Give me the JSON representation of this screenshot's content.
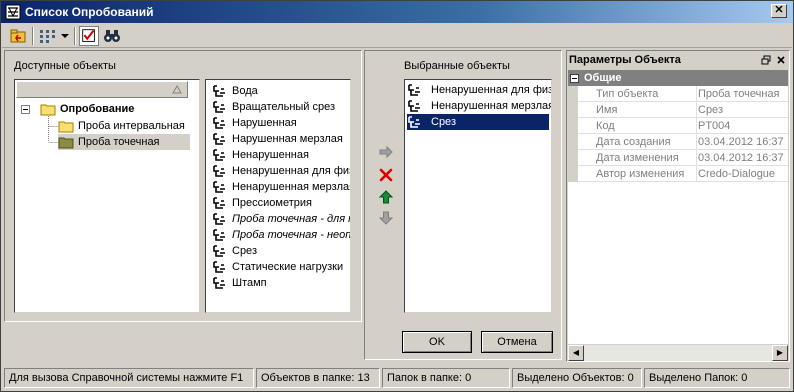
{
  "window": {
    "title": "Список Опробований",
    "close_glyph": "✕"
  },
  "toolbar": {
    "buttons": [
      {
        "icon": "open-folder-icon"
      },
      {
        "icon": "tree-view-icon"
      },
      {
        "icon": "checklist-icon"
      },
      {
        "icon": "binoculars-icon"
      }
    ]
  },
  "left": {
    "group_label": "Доступные объекты",
    "tree": {
      "root": "Опробование",
      "children": [
        "Проба интервальная",
        "Проба точечная"
      ]
    },
    "available_items": [
      {
        "label": "Вода",
        "italic": false
      },
      {
        "label": "Вращательный срез",
        "italic": false
      },
      {
        "label": "Нарушенная",
        "italic": false
      },
      {
        "label": "Нарушенная мерзлая",
        "italic": false
      },
      {
        "label": "Ненарушенная",
        "italic": false
      },
      {
        "label": "Ненарушенная для физ",
        "italic": false
      },
      {
        "label": "Ненарушенная мерзлая",
        "italic": false
      },
      {
        "label": "Прессиометрия",
        "italic": false
      },
      {
        "label": "Проба точечная - для п",
        "italic": true
      },
      {
        "label": "Проба точечная - неопр",
        "italic": true
      },
      {
        "label": "Срез",
        "italic": false
      },
      {
        "label": "Статические нагрузки",
        "italic": false
      },
      {
        "label": "Штамп",
        "italic": false
      }
    ]
  },
  "middle": {
    "group_label": "Выбранные объекты",
    "selected_items": [
      {
        "label": "Ненарушенная для физ"
      },
      {
        "label": "Ненарушенная мерзлая"
      },
      {
        "label": "Срез"
      }
    ],
    "highlighted_index": 2
  },
  "dialog_buttons": {
    "ok": "OK",
    "cancel": "Отмена"
  },
  "properties": {
    "title": "Параметры Объекта",
    "section": "Общие",
    "rows": [
      {
        "key": "Тип объекта",
        "value": "Проба точечная"
      },
      {
        "key": "Имя",
        "value": "Срез"
      },
      {
        "key": "Код",
        "value": "PT004"
      },
      {
        "key": "Дата создания",
        "value": "03.04.2012 16:37"
      },
      {
        "key": "Дата изменения",
        "value": "03.04.2012 16:37"
      },
      {
        "key": "Автор изменения",
        "value": "Credo-Dialogue"
      }
    ]
  },
  "statusbar": {
    "help": "Для вызова Справочной системы нажмите F1",
    "objects_in_folder": "Объектов в папке: 13",
    "folders_in_folder": "Папок в папке: 0",
    "selected_objects": "Выделено Объектов: 0",
    "selected_folders": "Выделено Папок: 0"
  },
  "colors": {
    "title_start": "#0a246a",
    "title_end": "#a6caf0",
    "selection": "#0a246a",
    "delete_red": "#e00000",
    "arrow_green": "#1a8a3a"
  }
}
